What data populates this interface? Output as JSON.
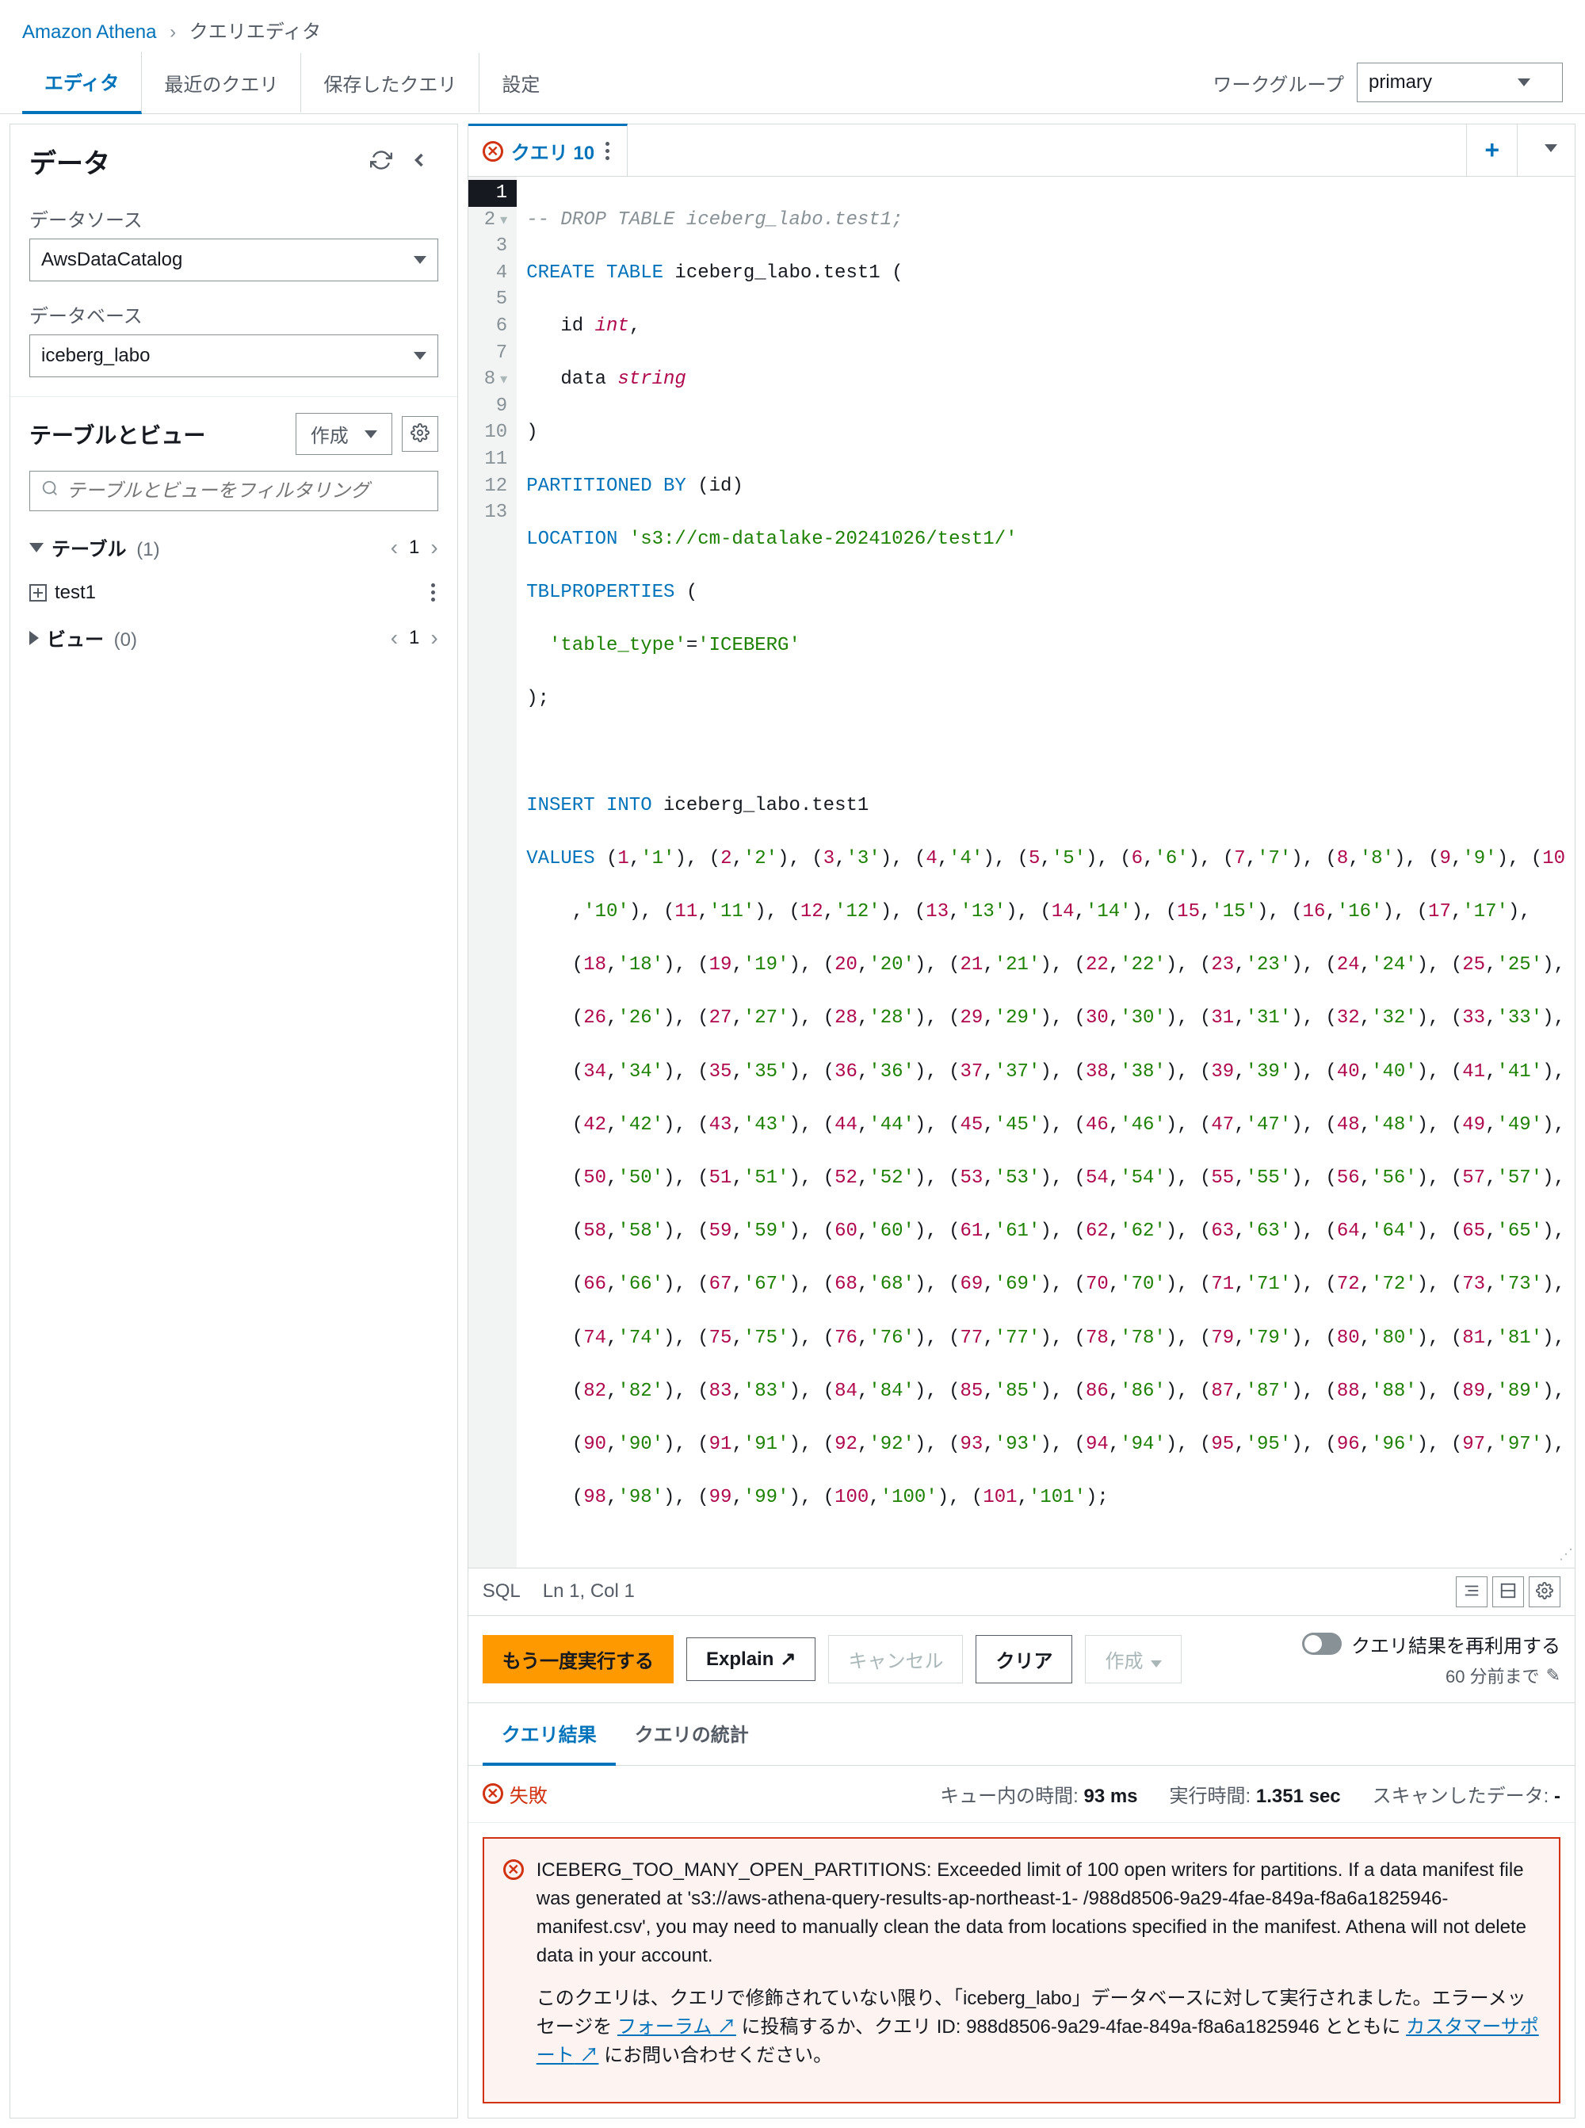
{
  "breadcrumb": {
    "service": "Amazon Athena",
    "page": "クエリエディタ"
  },
  "tabs": {
    "editor": "エディタ",
    "recent": "最近のクエリ",
    "saved": "保存したクエリ",
    "settings": "設定"
  },
  "workgroup": {
    "label": "ワークグループ",
    "value": "primary"
  },
  "sidebar": {
    "title": "データ",
    "datasource_label": "データソース",
    "datasource_value": "AwsDataCatalog",
    "database_label": "データベース",
    "database_value": "iceberg_labo",
    "tv_title": "テーブルとビュー",
    "create_label": "作成",
    "filter_placeholder": "テーブルとビューをフィルタリング",
    "tables_label": "テーブル",
    "tables_count": "(1)",
    "table_item": "test1",
    "views_label": "ビュー",
    "views_count": "(0)",
    "page_num": "1"
  },
  "query_tab": {
    "title": "クエリ 10"
  },
  "code": {
    "l1_comment": "-- DROP TABLE iceberg_labo.test1;",
    "l2_a": "CREATE TABLE",
    "l2_b": " iceberg_labo.test1 (",
    "l3_a": "   id ",
    "l3_b": "int",
    "l3_c": ",",
    "l4_a": "   data ",
    "l4_b": "string",
    "l5": ")",
    "l6_a": "PARTITIONED BY",
    "l6_b": " (id)",
    "l7_a": "LOCATION ",
    "l7_b": "'s3://cm-datalake-20241026/test1/'",
    "l8_a": "TBLPROPERTIES",
    "l8_b": " (",
    "l9_a": "  ",
    "l9_b": "'table_type'",
    "l9_c": "=",
    "l9_d": "'ICEBERG'",
    "l10": ");",
    "l12_a": "INSERT INTO",
    "l12_b": " iceberg_labo.test1",
    "l13_a": "VALUES",
    "l13_rest": " (1,'1'), (2,'2'), (3,'3'), (4,'4'), (5,'5'), (6,'6'), (7,'7'), (8,'8'), (9,'9'), (10",
    "l14": "    ,'10'), (11,'11'), (12,'12'), (13,'13'), (14,'14'), (15,'15'), (16,'16'), (17,'17'),",
    "l15": "    (18,'18'), (19,'19'), (20,'20'), (21,'21'), (22,'22'), (23,'23'), (24,'24'), (25,'25'),",
    "l16": "    (26,'26'), (27,'27'), (28,'28'), (29,'29'), (30,'30'), (31,'31'), (32,'32'), (33,'33'),",
    "l17": "    (34,'34'), (35,'35'), (36,'36'), (37,'37'), (38,'38'), (39,'39'), (40,'40'), (41,'41'),",
    "l18": "    (42,'42'), (43,'43'), (44,'44'), (45,'45'), (46,'46'), (47,'47'), (48,'48'), (49,'49'),",
    "l19": "    (50,'50'), (51,'51'), (52,'52'), (53,'53'), (54,'54'), (55,'55'), (56,'56'), (57,'57'),",
    "l20": "    (58,'58'), (59,'59'), (60,'60'), (61,'61'), (62,'62'), (63,'63'), (64,'64'), (65,'65'),",
    "l21": "    (66,'66'), (67,'67'), (68,'68'), (69,'69'), (70,'70'), (71,'71'), (72,'72'), (73,'73'),",
    "l22": "    (74,'74'), (75,'75'), (76,'76'), (77,'77'), (78,'78'), (79,'79'), (80,'80'), (81,'81'),",
    "l23": "    (82,'82'), (83,'83'), (84,'84'), (85,'85'), (86,'86'), (87,'87'), (88,'88'), (89,'89'),",
    "l24": "    (90,'90'), (91,'91'), (92,'92'), (93,'93'), (94,'94'), (95,'95'), (96,'96'), (97,'97'),",
    "l25": "    (98,'98'), (99,'99'), (100,'100'), (101,'101');"
  },
  "statusbar": {
    "lang": "SQL",
    "pos": "Ln 1, Col 1"
  },
  "actions": {
    "run": "もう一度実行する",
    "explain": "Explain",
    "cancel": "キャンセル",
    "clear": "クリア",
    "create": "作成",
    "reuse": "クエリ結果を再利用する",
    "reuse_sub": "60 分前まで"
  },
  "result_tabs": {
    "results": "クエリ結果",
    "stats": "クエリの統計"
  },
  "result_status": {
    "fail": "失敗",
    "queue_label": "キュー内の時間:",
    "queue_val": "93 ms",
    "exec_label": "実行時間:",
    "exec_val": "1.351 sec",
    "scan_label": "スキャンしたデータ:",
    "scan_val": "-"
  },
  "error": {
    "msg1": "ICEBERG_TOO_MANY_OPEN_PARTITIONS: Exceeded limit of 100 open writers for partitions. If a data manifest file was generated at 's3://aws-athena-query-results-ap-northeast-1-                    /988d8506-9a29-4fae-849a-f8a6a1825946-manifest.csv', you may need to manually clean the data from locations specified in the manifest. Athena will not delete data in your account.",
    "msg2_a": "このクエリは、クエリで修飾されていない限り、「iceberg_labo」データベースに対して実行されました。エラーメッセージを ",
    "msg2_forum": "フォーラム",
    "msg2_b": " に投稿するか、クエリ ID: 988d8506-9a29-4fae-849a-f8a6a1825946 とともに ",
    "msg2_support": "カスタマーサポート",
    "msg2_c": " にお問い合わせください。"
  }
}
